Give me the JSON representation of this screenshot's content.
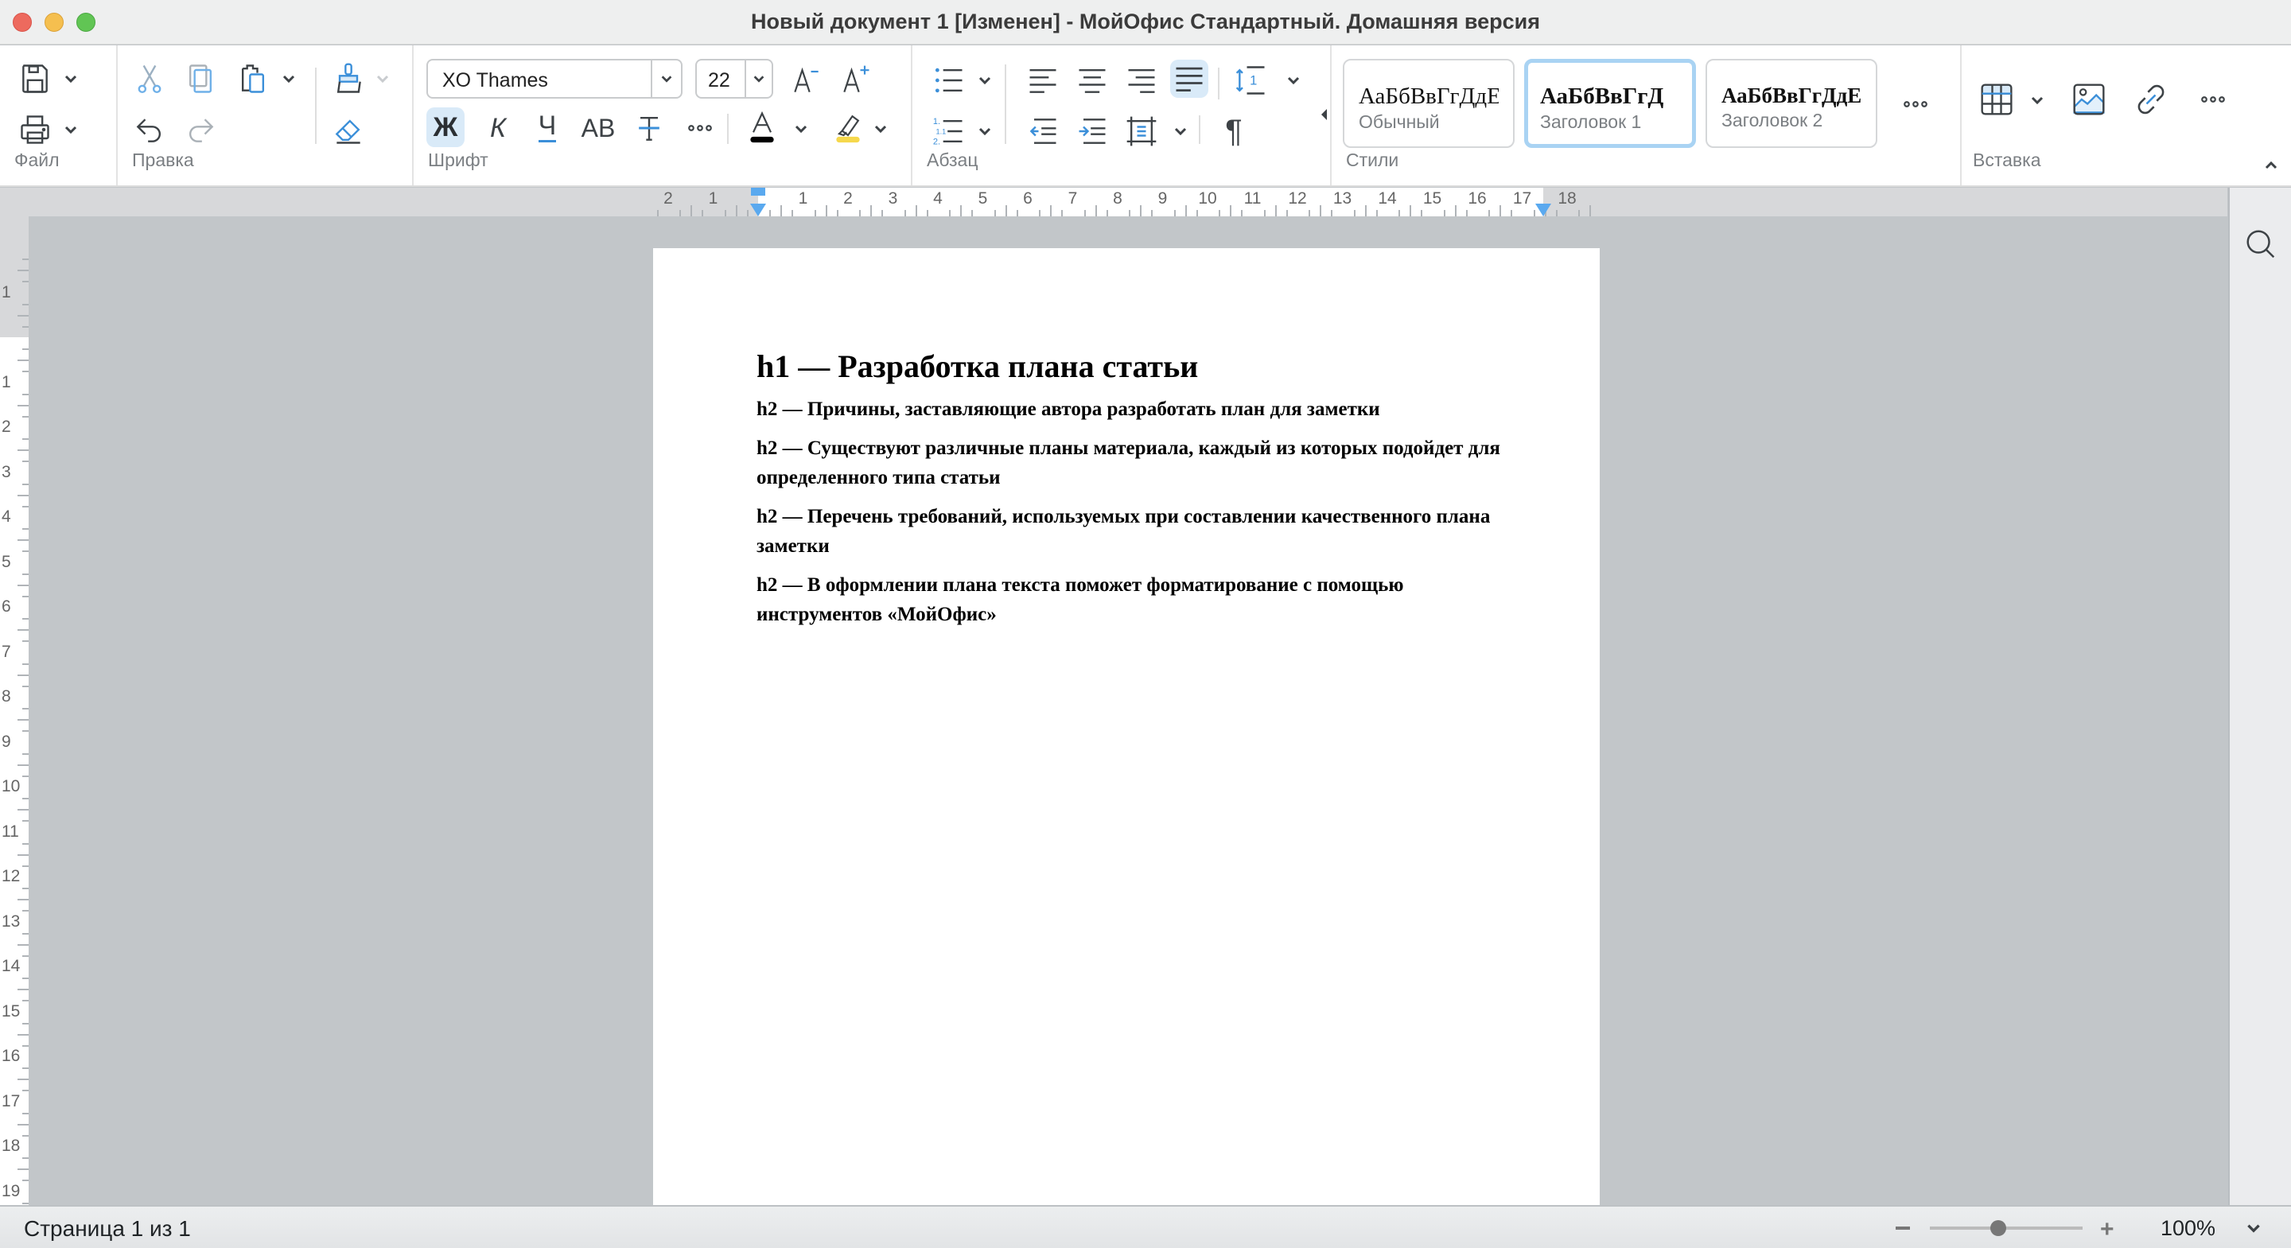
{
  "window": {
    "title": "Новый документ 1 [Изменен] - МойОфис Стандартный. Домашняя версия"
  },
  "toolbar": {
    "groups": {
      "file": "Файл",
      "edit": "Правка",
      "font": "Шрифт",
      "paragraph": "Абзац",
      "styles": "Стили",
      "insert": "Вставка"
    },
    "font_name": "XO Thames",
    "font_size": "22",
    "bold_label": "Ж",
    "italic_label": "К",
    "underline_label": "Ч",
    "caps_label": "АВ",
    "styles": [
      {
        "sample": "АаБбВвГгДдЕе",
        "name": "Обычный",
        "active": false
      },
      {
        "sample": "АаБбВвГгД",
        "name": "Заголовок 1",
        "active": true
      },
      {
        "sample": "АаБбВвГгДдЕ",
        "name": "Заголовок 2",
        "active": false
      }
    ],
    "text_color": "#000000",
    "highlight_color": "#f6d84c",
    "accent_color": "#3b8fd9"
  },
  "ruler": {
    "horizontal_labels": [
      "2",
      "1",
      "1",
      "2",
      "3",
      "4",
      "5",
      "6",
      "7",
      "8",
      "9",
      "10",
      "11",
      "12",
      "13",
      "14",
      "15",
      "16",
      "17",
      "18"
    ],
    "vertical_labels": [
      "1",
      "1",
      "2",
      "3",
      "4",
      "5",
      "6",
      "7",
      "8",
      "9",
      "10",
      "11",
      "12",
      "13",
      "14",
      "15",
      "16",
      "17",
      "18",
      "19"
    ]
  },
  "document": {
    "heading1": "h1 — Разработка плана статьи",
    "heading2": [
      "h2 — Причины, заставляющие автора разработать план для заметки",
      "h2 — Существуют различные планы материала, каждый из которых подойдет для определенного типа статьи",
      "h2 — Перечень требований, используемых при составлении качественного плана заметки",
      "h2 — В оформлении плана текста поможет форматирование с помощью инструментов «МойОфис»"
    ]
  },
  "statusbar": {
    "page_info": "Страница 1 из 1",
    "zoom_percent": "100%",
    "zoom_slider_fraction": 0.45
  }
}
